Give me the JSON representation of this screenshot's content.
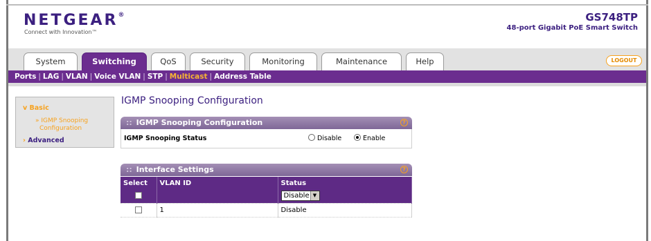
{
  "header": {
    "logo": "NETGEAR",
    "logo_mark": "®",
    "tagline": "Connect with Innovation™",
    "model": "GS748TP",
    "model_desc": "48-port Gigabit PoE Smart Switch"
  },
  "tabs": [
    {
      "label": "System"
    },
    {
      "label": "Switching"
    },
    {
      "label": "QoS"
    },
    {
      "label": "Security"
    },
    {
      "label": "Monitoring"
    },
    {
      "label": "Maintenance"
    },
    {
      "label": "Help"
    }
  ],
  "logout_label": "LOGOUT",
  "subnav": {
    "items": [
      "Ports",
      "LAG",
      "VLAN",
      "Voice VLAN",
      "STP",
      "Multicast",
      "Address Table"
    ],
    "separator": "|"
  },
  "leftmenu": {
    "basic": "Basic",
    "basic_arrow": "v",
    "sub_item_line1": "» IGMP Snooping",
    "sub_item_line2": "Configuration",
    "advanced": "Advanced",
    "advanced_arrow": "›"
  },
  "page_title": "IGMP Snooping Configuration",
  "igmp_panel": {
    "title": "IGMP Snooping Configuration",
    "status_label": "IGMP Snooping Status",
    "options": [
      "Disable",
      "Enable"
    ],
    "selected": "Enable"
  },
  "interface_panel": {
    "title": "Interface Settings",
    "columns": [
      "Select",
      "VLAN ID",
      "Status"
    ],
    "edit_row_status": "Disable",
    "rows": [
      {
        "vlan_id": "1",
        "status": "Disable"
      }
    ]
  },
  "help_glyph": "?",
  "panel_dots": "::",
  "colors": {
    "purple": "#6b2d8f",
    "brand": "#3c2080",
    "orange": "#f7a21e"
  }
}
